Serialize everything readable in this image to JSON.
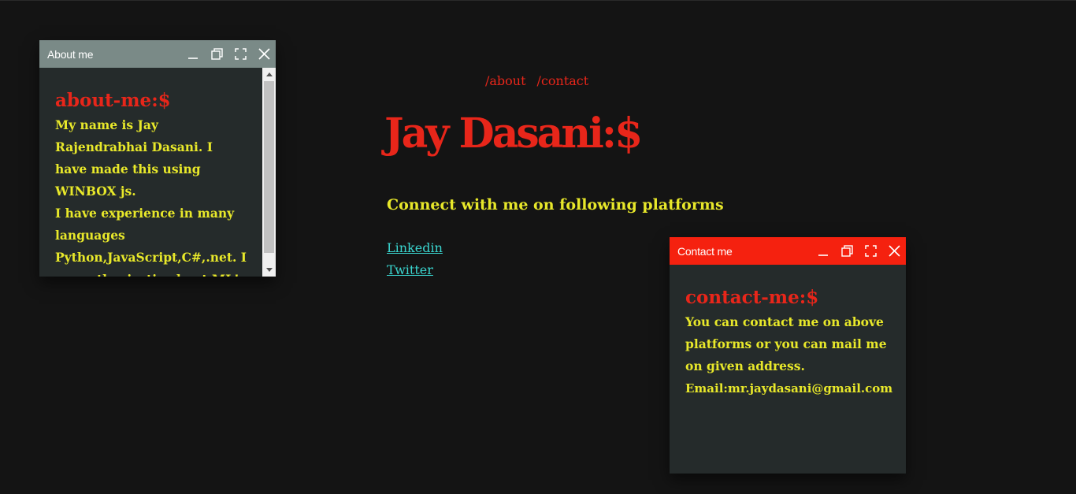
{
  "nav": {
    "about": "/about",
    "contact": "/contact"
  },
  "hero": {
    "title": "Jay Dasani:$"
  },
  "connect": {
    "heading": "Connect with me on following platforms",
    "links": [
      "Linkedin",
      "Twitter"
    ]
  },
  "about_window": {
    "title": "About me",
    "header_color": "#7a8a87",
    "heading": "about-me:$",
    "paragraphs": [
      "My name is Jay Rajendrabhai Dasani. I have made this using WINBOX js.",
      "I have experience in many languages Python,JavaScript,C#,.net. I am enthusiastic about ML!"
    ],
    "controls": [
      "minimize-icon",
      "restore-icon",
      "fullscreen-icon",
      "close-icon"
    ]
  },
  "contact_window": {
    "title": "Contact me",
    "header_color": "#f5210f",
    "heading": "contact-me:$",
    "paragraphs": [
      "You can contact me on above platforms or you can mail me on given address.",
      "Email:mr.jaydasani@gmail.com"
    ],
    "controls": [
      "minimize-icon",
      "restore-icon",
      "fullscreen-icon",
      "close-icon"
    ]
  },
  "colors": {
    "background": "#141414",
    "accent_red": "#e8261a",
    "text_yellow": "#e8e82a",
    "link_cyan": "#3ad6d0",
    "window_body": "#252b2b"
  }
}
